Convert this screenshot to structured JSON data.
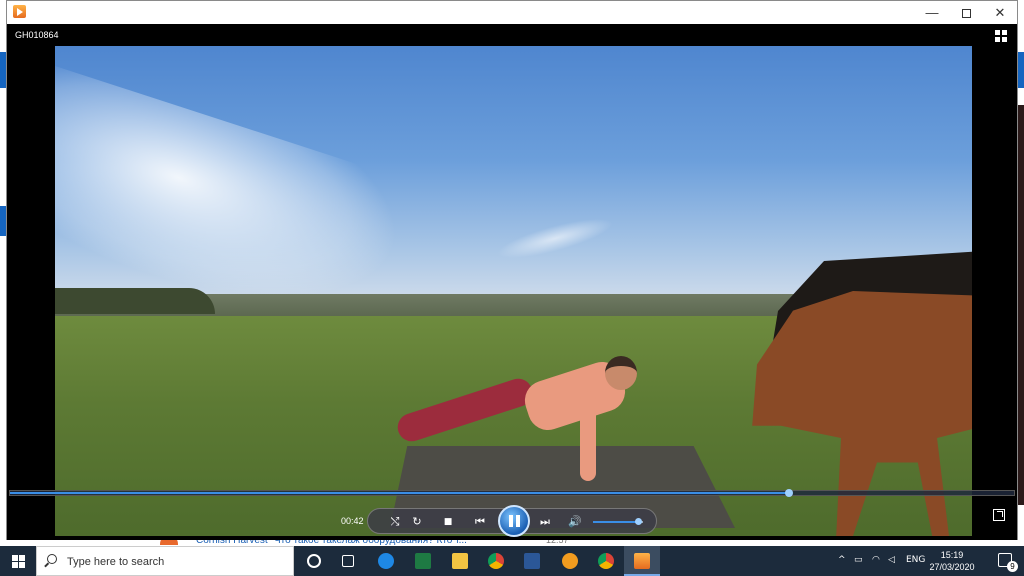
{
  "window": {
    "file_name": "GH010864",
    "minimize": "—",
    "close": "✕"
  },
  "player": {
    "time_elapsed": "00:42",
    "progress": 0.776,
    "volume": 0.9,
    "state": "playing",
    "controls": {
      "shuffle": "⤭",
      "repeat": "↻",
      "stop": "■",
      "previous": "⏮",
      "next": "⏭",
      "mute": "🔊"
    }
  },
  "background_app": {
    "row_text": "Cornish Harvest  \"Что такое такелаж оборудования? Кто т...",
    "row_time": "12:57"
  },
  "taskbar": {
    "search_placeholder": "Type here to search",
    "apps": [
      "cortana-icon",
      "task-view-icon",
      "edge-icon",
      "excel-icon",
      "file-explorer-icon",
      "chrome-icon",
      "word-icon",
      "vpn-icon",
      "chrome-profile-icon",
      "media-player-icon"
    ],
    "tray": {
      "chevron": "^",
      "language": "ENG",
      "time": "15:19",
      "date": "27/03/2020",
      "notifications": "9"
    }
  },
  "colors": {
    "accent": "#1b5fb3",
    "taskbar": "#1c2b3c",
    "seek_fill": "#3a8ee6"
  }
}
